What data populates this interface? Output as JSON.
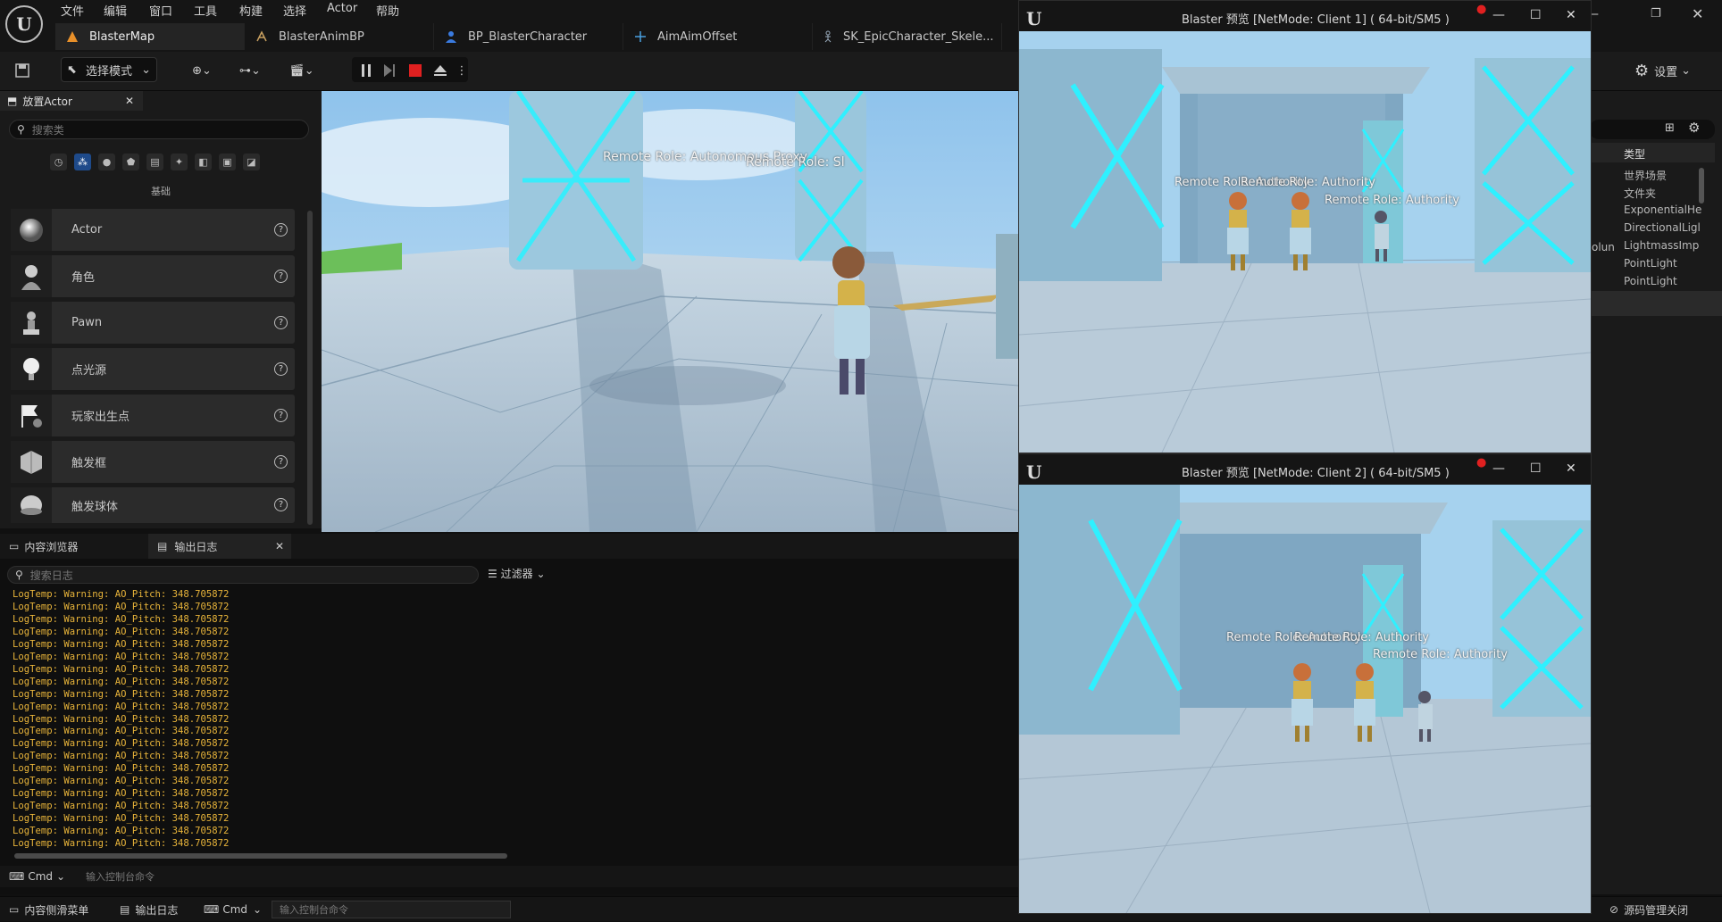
{
  "menu": [
    "文件",
    "编辑",
    "窗口",
    "工具",
    "构建",
    "选择",
    "Actor",
    "帮助"
  ],
  "tabs": [
    {
      "label": "BlasterMap",
      "icon": "level-icon"
    },
    {
      "label": "BlasterAnimBP",
      "icon": "anim-blueprint-icon"
    },
    {
      "label": "BP_BlasterCharacter",
      "icon": "character-blueprint-icon"
    },
    {
      "label": "AimAimOffset",
      "icon": "aim-offset-icon"
    },
    {
      "label": "SK_EpicCharacter_Skele...",
      "icon": "skeleton-icon"
    }
  ],
  "toolbar": {
    "mode": "选择模式",
    "settings": "设置"
  },
  "place": {
    "tab": "放置Actor",
    "search_placeholder": "搜索类",
    "section": "基础",
    "items": [
      {
        "label": "Actor",
        "icon": "sphere-icon"
      },
      {
        "label": "角色",
        "icon": "character-icon"
      },
      {
        "label": "Pawn",
        "icon": "pawn-icon"
      },
      {
        "label": "点光源",
        "icon": "point-light-icon"
      },
      {
        "label": "玩家出生点",
        "icon": "player-start-icon"
      },
      {
        "label": "触发框",
        "icon": "trigger-box-icon"
      },
      {
        "label": "触发球体",
        "icon": "trigger-sphere-icon"
      }
    ]
  },
  "viewport": {
    "overlay1": "Remote Role: Autonomous Proxy",
    "overlay2": "Remote Role: Sl"
  },
  "log": {
    "tab_content": "内容浏览器",
    "tab_output": "输出日志",
    "search_placeholder": "搜索日志",
    "filter": "过滤器",
    "line": "LogTemp: Warning: AO_Pitch: 348.705872",
    "line_count": 21,
    "cmd_label": "Cmd",
    "cmd_placeholder": "输入控制台命令"
  },
  "status": {
    "drawer": "内容侧滑菜单",
    "output": "输出日志",
    "cmd_label": "Cmd",
    "cmd_placeholder": "输入控制台命令",
    "source_control": "源码管理关闭"
  },
  "outliner": {
    "header": "类型",
    "rows": [
      "世界场景",
      "文件夹",
      "ExponentialHe",
      "DirectionalLigl",
      "LightmassImp",
      "PointLight",
      "PointLight"
    ],
    "side_text": "olun"
  },
  "client1": {
    "title": "Blaster 预览 [NetMode: Client 1]  ( 64-bit/SM5 )",
    "overlay1": "Remote Role: Authority",
    "overlay2": "Remote Role: Authority",
    "overlay3": "Remote Role: Authority"
  },
  "client2": {
    "title": "Blaster 预览 [NetMode: Client 2]  ( 64-bit/SM5 )",
    "overlay1": "Remote Role: Authority",
    "overlay2": "Remote Role: Authority",
    "overlay3": "Remote Role: Authority"
  },
  "colors": {
    "log_warning": "#e8b43a",
    "accent_blue": "#1e6fd9",
    "stop_red": "#e02020"
  }
}
